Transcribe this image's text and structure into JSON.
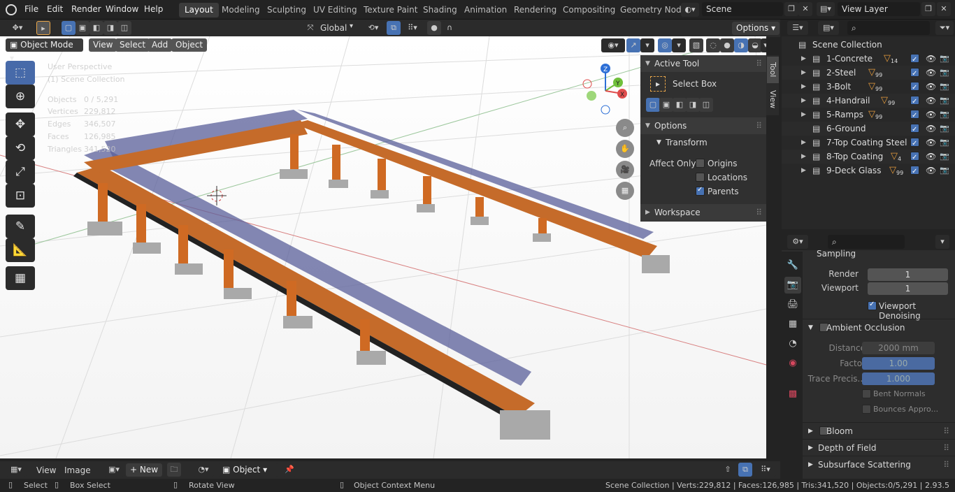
{
  "topbar": {
    "menus": [
      "File",
      "Edit",
      "Render",
      "Window",
      "Help"
    ],
    "workspaces": [
      "Layout",
      "Modeling",
      "Sculpting",
      "UV Editing",
      "Texture Paint",
      "Shading",
      "Animation",
      "Rendering",
      "Compositing",
      "Geometry Nod"
    ],
    "scene_name": "Scene",
    "view_layer": "View Layer"
  },
  "viewport_header": {
    "orientation": "Global",
    "options": "Options",
    "mode": "Object Mode",
    "menus": [
      "View",
      "Select",
      "Add",
      "Object"
    ]
  },
  "overlay": {
    "perspective": "User Perspective",
    "collection": "(1) Scene Collection",
    "stats": [
      {
        "label": "Objects",
        "value": "0 / 5,291"
      },
      {
        "label": "Vertices",
        "value": "229,812"
      },
      {
        "label": "Edges",
        "value": "346,507"
      },
      {
        "label": "Faces",
        "value": "126,985"
      },
      {
        "label": "Triangles",
        "value": "341,520"
      }
    ]
  },
  "gizmo": {
    "z": "Z",
    "y": "Y",
    "x": "X"
  },
  "npanel": {
    "active_tool_title": "Active Tool",
    "tool_name": "Select Box",
    "options_title": "Options",
    "transform_title": "Transform",
    "affect_only": "Affect Only",
    "origins": "Origins",
    "locations": "Locations",
    "parents": "Parents",
    "workspace_title": "Workspace",
    "tab_tool": "Tool",
    "tab_view": "View"
  },
  "outliner": {
    "root": "Scene Collection",
    "items": [
      {
        "name": "1-Concrete",
        "count": "14",
        "has_expand": true
      },
      {
        "name": "2-Steel",
        "count": "99",
        "has_expand": true
      },
      {
        "name": "3-Bolt",
        "count": "99",
        "has_expand": true
      },
      {
        "name": "4-Handrail",
        "count": "99",
        "has_expand": true
      },
      {
        "name": "5-Ramps",
        "count": "99",
        "has_expand": true
      },
      {
        "name": "6-Ground",
        "count": "",
        "has_expand": false
      },
      {
        "name": "7-Top Coating Steel",
        "count": "",
        "has_expand": true
      },
      {
        "name": "8-Top Coating",
        "count": "4",
        "has_expand": true
      },
      {
        "name": "9-Deck Glass",
        "count": "99",
        "has_expand": true
      }
    ]
  },
  "properties": {
    "sampling": "Sampling",
    "render_label": "Render",
    "render_value": "1",
    "viewport_label": "Viewport",
    "viewport_value": "1",
    "viewport_denoising": "Viewport Denoising",
    "ambient_occlusion": "Ambient Occlusion",
    "distance_label": "Distance",
    "distance_value": "2000 mm",
    "factor_label": "Factor",
    "factor_value": "1.00",
    "trace_label": "Trace Precis...",
    "trace_value": "1.000",
    "bent_normals": "Bent Normals",
    "bounces": "Bounces Appro...",
    "bloom": "Bloom",
    "dof": "Depth of Field",
    "sss": "Subsurface Scattering"
  },
  "bottom_header": {
    "view": "View",
    "image": "Image",
    "new": "New",
    "object": "Object"
  },
  "status": {
    "select": "Select",
    "box_select": "Box Select",
    "rotate_view": "Rotate View",
    "context_menu": "Object Context Menu",
    "info": "Scene Collection | Verts:229,812 | Faces:126,985 | Tris:341,520 | Objects:0/5,291 | 2.93.5"
  },
  "colors": {
    "accent": "#4772b3",
    "viewport_bg": "#3d3d3d",
    "steel_orange": "#d2691e",
    "glass_blue": "#6b6fb0"
  }
}
